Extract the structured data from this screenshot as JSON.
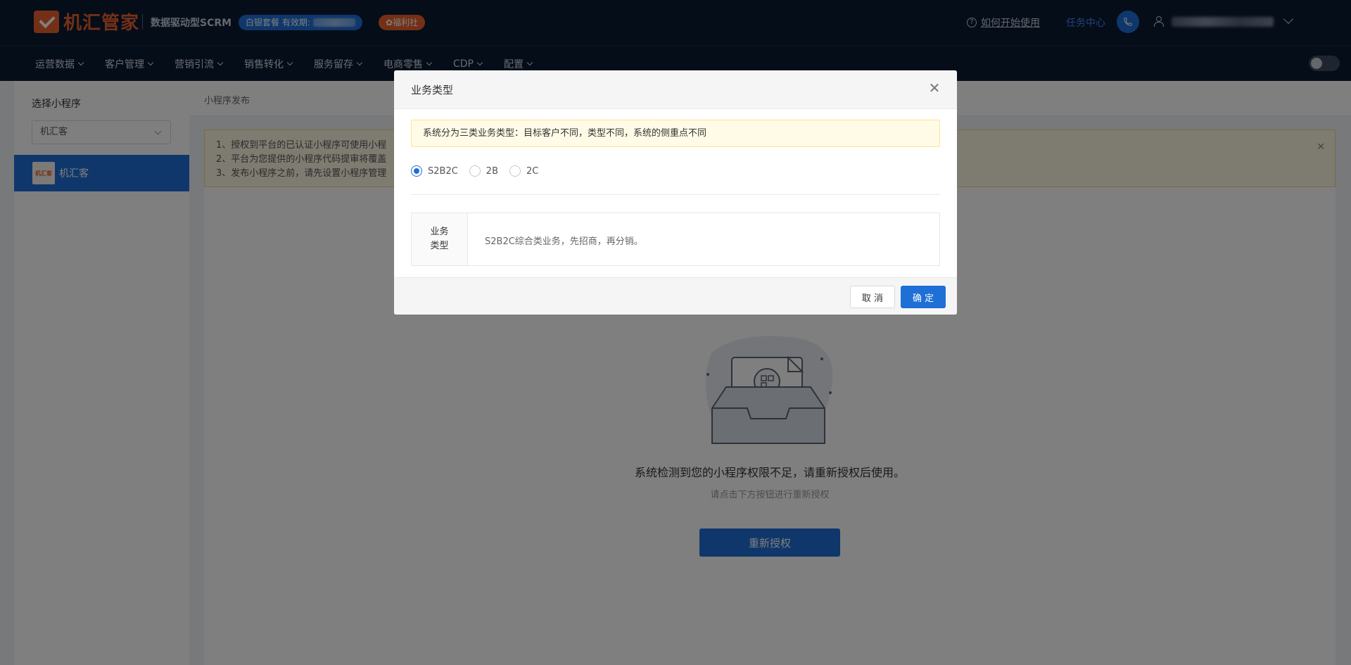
{
  "header": {
    "brand": "机汇管家",
    "subtitle": "数据驱动型SCRM",
    "package_label": "白银套餐 有效期:",
    "welfare_label": "✿福利社",
    "help_link": "如何开始使用",
    "task_center": "任务中心",
    "icons": {
      "help": "question-circle-icon",
      "phone": "phone-icon",
      "user": "user-icon",
      "caret": "chevron-down-icon"
    }
  },
  "nav": {
    "items": [
      "运营数据",
      "客户管理",
      "营销引流",
      "销售转化",
      "服务留存",
      "电商零售",
      "CDP",
      "配置"
    ]
  },
  "sidebar": {
    "title": "选择小程序",
    "select_value": "机汇客",
    "items": [
      {
        "label": "机汇客",
        "logo_text": "机汇客"
      }
    ]
  },
  "breadcrumb": "小程序发布",
  "notice": {
    "lines": [
      "1、授权到平台的已认证小程序可使用小程",
      "2、平台为您提供的小程序代码提审将覆盖",
      "3、发布小程序之前，请先设置小程序管理"
    ]
  },
  "empty_state": {
    "message": "系统检测到您的小程序权限不足，请重新授权后使用。",
    "hint": "请点击下方按钮进行重新授权",
    "button": "重新授权"
  },
  "modal": {
    "title": "业务类型",
    "alert": "系统分为三类业务类型：目标客户不同，类型不同，系统的侧重点不同",
    "options": [
      "S2B2C",
      "2B",
      "2C"
    ],
    "selected": "S2B2C",
    "desc_label": "业务类型",
    "desc_value": "S2B2C综合类业务，先招商，再分销。",
    "cancel": "取 消",
    "confirm": "确 定"
  },
  "colors": {
    "header_bg": "#0b1a33",
    "accent": "#1e6fd6",
    "brand": "#e8612c"
  }
}
